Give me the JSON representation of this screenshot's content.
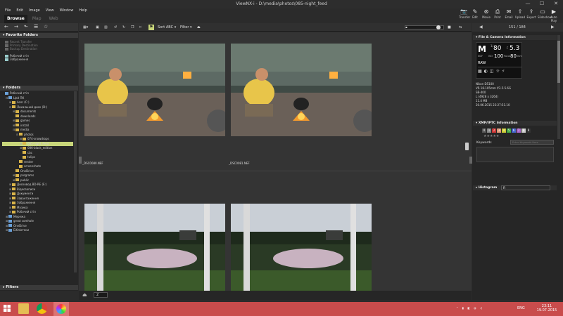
{
  "window": {
    "title": "ViewNX-i - D:\\media\\photos\\085-night_feed",
    "controls": [
      "—",
      "☐",
      "✕"
    ]
  },
  "menu": [
    "File",
    "Edit",
    "Image",
    "View",
    "Window",
    "Help"
  ],
  "modes": [
    "Browse",
    "Map",
    "Web"
  ],
  "top_actions": [
    {
      "label": "Transfer",
      "icon": "camera-icon",
      "glyph": "📷"
    },
    {
      "label": "Edit",
      "icon": "edit-icon",
      "glyph": "✎"
    },
    {
      "label": "Movie",
      "icon": "movie-icon",
      "glyph": "⊛"
    },
    {
      "label": "Print",
      "icon": "print-icon",
      "glyph": "⎙"
    },
    {
      "label": "Email",
      "icon": "email-icon",
      "glyph": "✉"
    },
    {
      "label": "Upload",
      "icon": "upload-icon",
      "glyph": "⇧"
    },
    {
      "label": "Export",
      "icon": "export-icon",
      "glyph": "⇪"
    },
    {
      "label": "Slideshow",
      "icon": "slideshow-icon",
      "glyph": "▭"
    },
    {
      "label": "Auto Play",
      "icon": "autoplay-icon",
      "glyph": "▶"
    }
  ],
  "favorites": {
    "header": "Favorite Folders",
    "items": [
      {
        "label": "Recent Transfer",
        "dim": true
      },
      {
        "label": "Primary Destination",
        "dim": true
      },
      {
        "label": "Backup Destination",
        "dim": true
      },
      {
        "label": "Робочий стіл",
        "dim": false
      },
      {
        "label": "Зображення",
        "dim": false
      }
    ]
  },
  "folders": {
    "header": "Folders",
    "tree": [
      {
        "label": "Робочий стіл",
        "indent": 0,
        "exp": "",
        "sel": false
      },
      {
        "label": "Цей ПК",
        "indent": 1,
        "exp": "⊟",
        "sel": false
      },
      {
        "label": "Acer (C:)",
        "indent": 2,
        "exp": "⊞",
        "sel": false
      },
      {
        "label": "Локальний диск (D:)",
        "indent": 2,
        "exp": "⊟",
        "sel": false
      },
      {
        "label": "documents",
        "indent": 3,
        "exp": "⊞",
        "sel": false
      },
      {
        "label": "downloads",
        "indent": 3,
        "exp": "",
        "sel": false
      },
      {
        "label": "games",
        "indent": 3,
        "exp": "⊞",
        "sel": false
      },
      {
        "label": "install",
        "indent": 3,
        "exp": "⊞",
        "sel": false
      },
      {
        "label": "media",
        "indent": 3,
        "exp": "⊟",
        "sel": false
      },
      {
        "label": "photos",
        "indent": 4,
        "exp": "⊟",
        "sel": false
      },
      {
        "label": "074-snowdrops",
        "indent": 5,
        "exp": "⊞",
        "sel": false
      },
      {
        "label": "085-night_feed",
        "indent": 5,
        "exp": "⊞",
        "sel": true
      },
      {
        "label": "086-black_edition",
        "indent": 5,
        "exp": "⊞",
        "sel": false
      },
      {
        "label": "cbc",
        "indent": 5,
        "exp": "",
        "sel": false
      },
      {
        "label": "tulips",
        "indent": 5,
        "exp": "",
        "sel": false
      },
      {
        "label": "render",
        "indent": 4,
        "exp": "",
        "sel": false
      },
      {
        "label": "screenshots",
        "indent": 4,
        "exp": "",
        "sel": false
      },
      {
        "label": "OneDrive",
        "indent": 3,
        "exp": "",
        "sel": false
      },
      {
        "label": "programs",
        "indent": 3,
        "exp": "⊞",
        "sel": false
      },
      {
        "label": "public",
        "indent": 3,
        "exp": "⊞",
        "sel": false
      },
      {
        "label": "Дисковод BD-RE (E:)",
        "indent": 2,
        "exp": "⊞",
        "sel": false
      },
      {
        "label": "Відеозаписи",
        "indent": 2,
        "exp": "⊞",
        "sel": false
      },
      {
        "label": "Документи",
        "indent": 2,
        "exp": "⊞",
        "sel": false
      },
      {
        "label": "Завантаження",
        "indent": 2,
        "exp": "⊞",
        "sel": false
      },
      {
        "label": "Зображення",
        "indent": 2,
        "exp": "⊞",
        "sel": false
      },
      {
        "label": "Музика",
        "indent": 2,
        "exp": "⊞",
        "sel": false
      },
      {
        "label": "Робочий стіл",
        "indent": 2,
        "exp": "⊞",
        "sel": false
      },
      {
        "label": "Мережа",
        "indent": 1,
        "exp": "⊞",
        "sel": false
      },
      {
        "label": "great comhole",
        "indent": 1,
        "exp": "⊞",
        "sel": false
      },
      {
        "label": "OneDrive",
        "indent": 1,
        "exp": "⊞",
        "sel": false
      },
      {
        "label": "Бібліотеки",
        "indent": 1,
        "exp": "⊞",
        "sel": false
      }
    ]
  },
  "filters_label": "Filters",
  "toolbar": {
    "sort_label": "Sort",
    "sort_value": "ABC",
    "filter_label": "Filter",
    "filter_arrow": "▾"
  },
  "thumbnails": [
    {
      "file": "_DSC0080.NEF",
      "scene": "cook"
    },
    {
      "file": "_DSC0081.NEF",
      "scene": "cook"
    },
    {
      "file": "",
      "scene": "pond"
    },
    {
      "file": "",
      "scene": "pond"
    }
  ],
  "nav": {
    "prev": "◀",
    "next": "▶",
    "counter": "151 / 184"
  },
  "info": {
    "file_camera_header": "File & Camera Information",
    "mode": "M",
    "shutter_prefix": "1/",
    "shutter": "80",
    "aperture_prefix": "F",
    "aperture": "5.3",
    "iso_label": "ISO",
    "iso": "100",
    "focal_label": "Focal",
    "focal": "80",
    "focal_unit": "mm",
    "ev_label": "NCF",
    "raw": "RAW",
    "lines": [
      "Nikon D5100",
      "VR 18-105mm f/3.5-5.6G",
      "SB-400",
      "L (4928 x 3264)",
      "11.4 MB",
      "20.06.2015 22:27:51.10"
    ]
  },
  "xmp": {
    "header": "XMP/IPTC Information",
    "labels": [
      "0",
      "1",
      "2",
      "3",
      "4",
      "5",
      "6",
      "7",
      "8",
      "9"
    ],
    "label_colors": [
      "#555",
      "#888",
      "#c33",
      "#d97",
      "#cc3",
      "#4a4",
      "#46c",
      "#a6c",
      "#ccc",
      "#333"
    ],
    "stars": "★★★★★",
    "keywords_label": "Keywords",
    "keywords_placeholder": "Enter Keywords Here"
  },
  "histogram": {
    "label": "Histogram",
    "channel": "R"
  },
  "bottom": {
    "count": "2"
  },
  "taskbar": {
    "time": "23:11",
    "date": "19.07.2015",
    "lang": "ENG"
  }
}
